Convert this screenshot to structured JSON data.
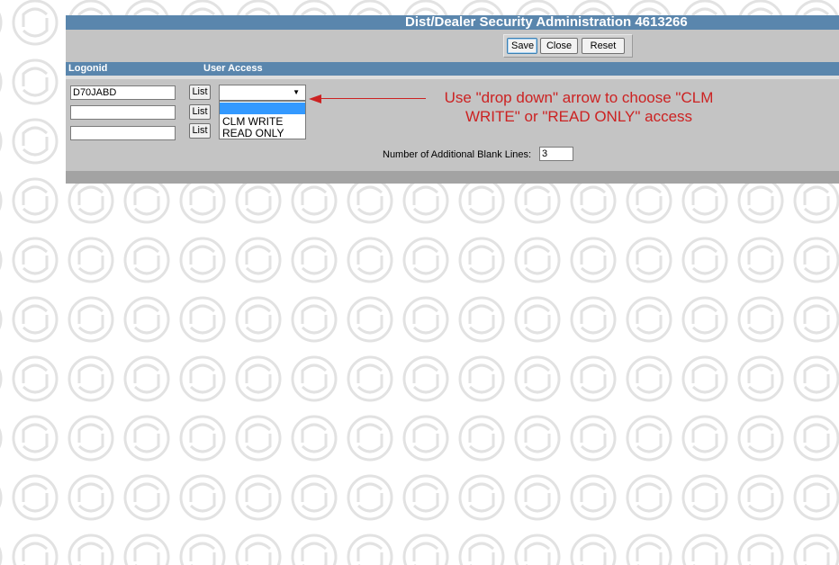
{
  "title_bar": {
    "title": "Dist/Dealer Security Administration   4613266"
  },
  "toolbar": {
    "save_label": "Save",
    "close_label": "Close",
    "reset_label": "Reset"
  },
  "columns": {
    "logonid": "Logonid",
    "user_access": "User Access"
  },
  "rows": [
    {
      "logonid": "D70JABD",
      "list_label": "List"
    },
    {
      "logonid": "",
      "list_label": "List"
    },
    {
      "logonid": "",
      "list_label": "List"
    }
  ],
  "access_select": {
    "selected": "",
    "options": [
      "",
      "CLM WRITE",
      "READ ONLY"
    ]
  },
  "annotation": {
    "text": "Use \"drop down\" arrow to choose \"CLM WRITE\" or \"READ ONLY\" access"
  },
  "blank_lines": {
    "label": "Number of Additional Blank Lines:",
    "value": "3"
  },
  "colors": {
    "title_bar": "#5a86ad",
    "panel": "#c4c4c4",
    "annotation": "#cc2222",
    "highlight": "#3399ff"
  },
  "icons": {
    "watermark": "refresh-circle-icon",
    "dropdown": "chevron-down-icon",
    "pointer": "arrow-left-icon"
  }
}
